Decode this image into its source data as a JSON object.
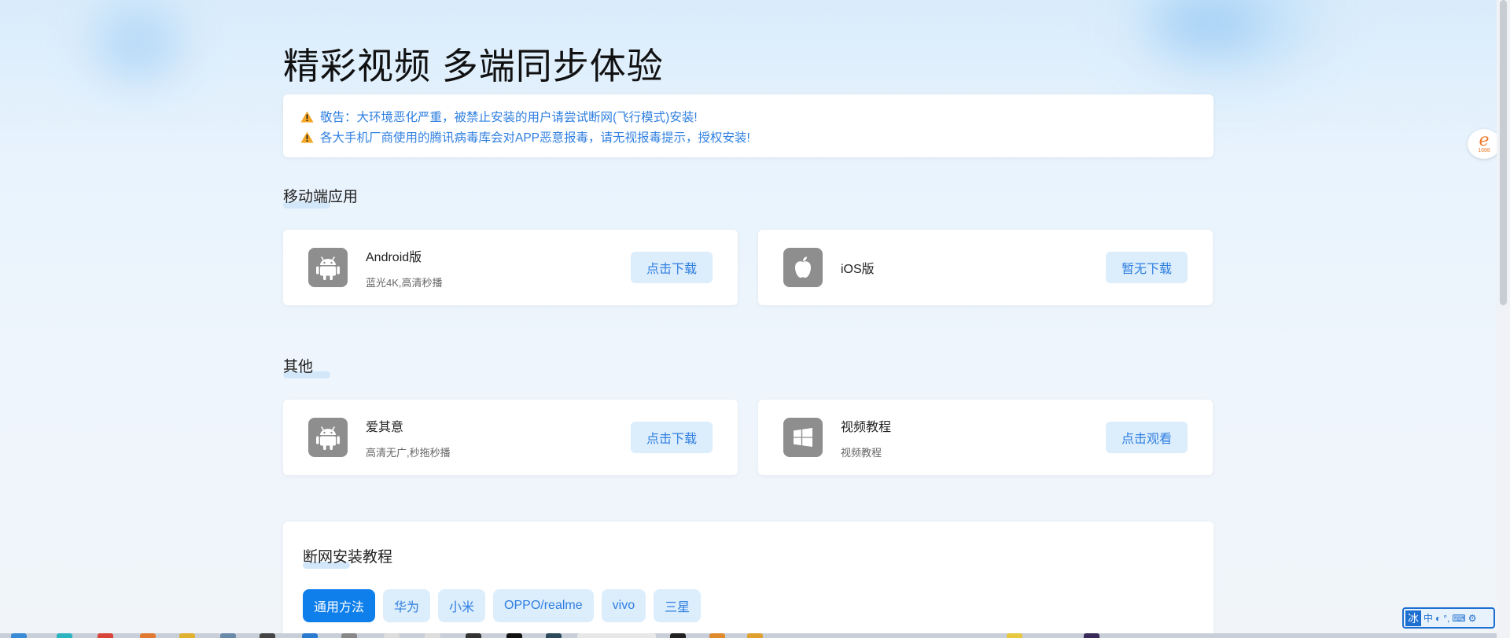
{
  "page": {
    "title": "精彩视频 多端同步体验"
  },
  "notice": {
    "lines": [
      "敬告：大环境恶化严重，被禁止安装的用户请尝试断网(飞行模式)安装!",
      "各大手机厂商使用的腾讯病毒库会对APP恶意报毒，请无视报毒提示，授权安装!"
    ]
  },
  "sections": {
    "mobile": {
      "title": "移动端应用",
      "cards": [
        {
          "name": "Android版",
          "desc": "蓝光4K,高清秒播",
          "button": "点击下载",
          "icon": "android-icon"
        },
        {
          "name": "iOS版",
          "desc": "",
          "button": "暂无下载",
          "icon": "apple-icon"
        }
      ]
    },
    "other": {
      "title": "其他",
      "cards": [
        {
          "name": "爱其意",
          "desc": "高清无广,秒拖秒播",
          "button": "点击下载",
          "icon": "android-icon"
        },
        {
          "name": "视频教程",
          "desc": "视频教程",
          "button": "点击观看",
          "icon": "windows-icon"
        }
      ]
    },
    "tutorial": {
      "title": "断网安装教程",
      "tabs": [
        "通用方法",
        "华为",
        "小米",
        "OPPO/realme",
        "vivo",
        "三星"
      ],
      "active_tab": "通用方法"
    }
  },
  "side_logo": {
    "glyph": "e",
    "text": "1688"
  },
  "ime": {
    "items": [
      "冰",
      "中"
    ]
  },
  "colors": {
    "accent": "#2f7fe0",
    "button_bg": "#dcedfc",
    "active_tab": "#0f7fec",
    "icon_bg": "#8e8e8e"
  }
}
